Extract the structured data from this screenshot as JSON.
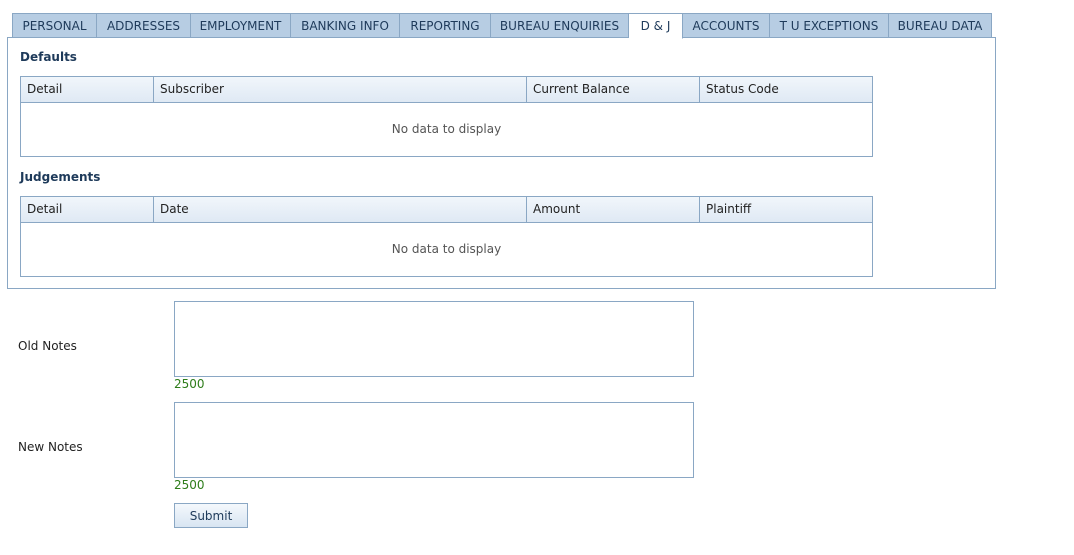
{
  "tabs": [
    {
      "label": "PERSONAL",
      "active": false
    },
    {
      "label": "ADDRESSES",
      "active": false
    },
    {
      "label": "EMPLOYMENT",
      "active": false
    },
    {
      "label": "BANKING INFO",
      "active": false
    },
    {
      "label": "REPORTING",
      "active": false
    },
    {
      "label": "BUREAU ENQUIRIES",
      "active": false
    },
    {
      "label": "D & J",
      "active": true
    },
    {
      "label": "ACCOUNTS",
      "active": false
    },
    {
      "label": "T U EXCEPTIONS",
      "active": false
    },
    {
      "label": "BUREAU DATA",
      "active": false
    }
  ],
  "defaults": {
    "title": "Defaults",
    "columns": [
      "Detail",
      "Subscriber",
      "Current Balance",
      "Status Code"
    ],
    "empty_text": "No data to display"
  },
  "judgements": {
    "title": "Judgements",
    "columns": [
      "Detail",
      "Date",
      "Amount",
      "Plaintiff"
    ],
    "empty_text": "No data to display"
  },
  "old_notes": {
    "label": "Old Notes",
    "value": "",
    "remaining": "2500"
  },
  "new_notes": {
    "label": "New Notes",
    "value": "",
    "remaining": "2500"
  },
  "submit_label": "Submit",
  "colors": {
    "tab_bg": "#b7cde3",
    "border": "#8aa7c4",
    "counter": "#2e7d1a"
  }
}
